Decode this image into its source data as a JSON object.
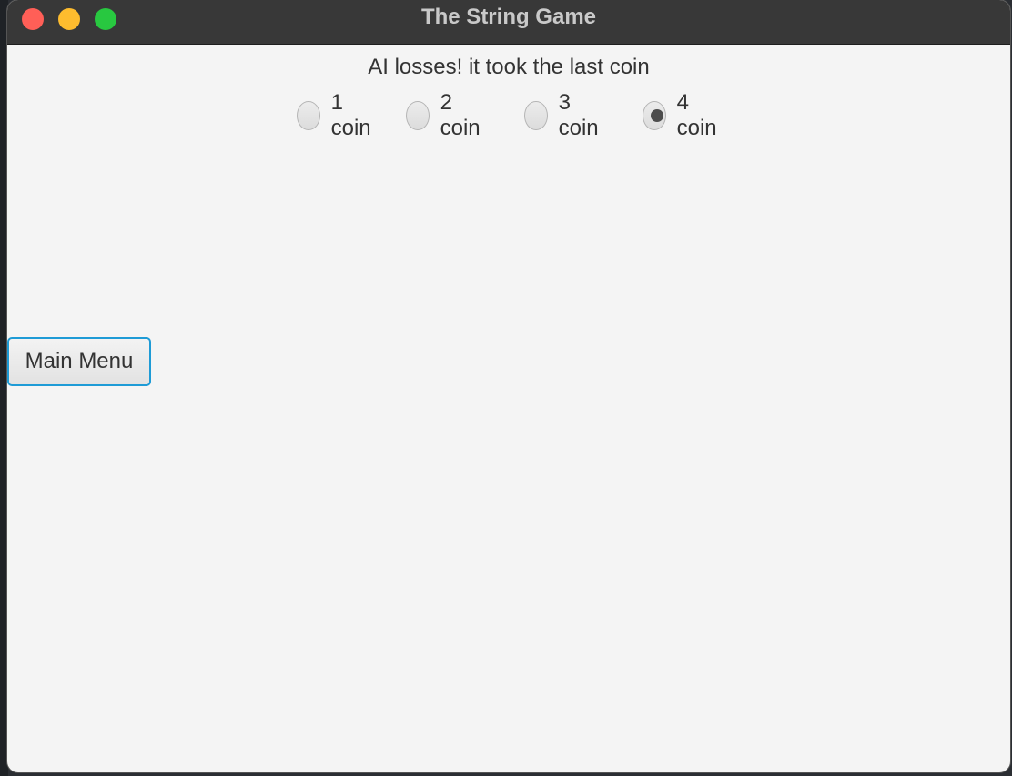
{
  "window": {
    "title": "The String Game"
  },
  "game": {
    "status": "AI losses! it took the last coin",
    "options": [
      {
        "label": "1 coin",
        "selected": false
      },
      {
        "label": "2 coin",
        "selected": false
      },
      {
        "label": "3 coin",
        "selected": false
      },
      {
        "label": "4 coin",
        "selected": true
      }
    ]
  },
  "controls": {
    "main_menu_label": "Main Menu"
  },
  "colors": {
    "titlebar": "#383838",
    "window_bg": "#f4f4f4",
    "focus_ring": "#1e9bd6",
    "close": "#ff5f57",
    "minimize": "#febc2e",
    "maximize": "#28c840"
  }
}
